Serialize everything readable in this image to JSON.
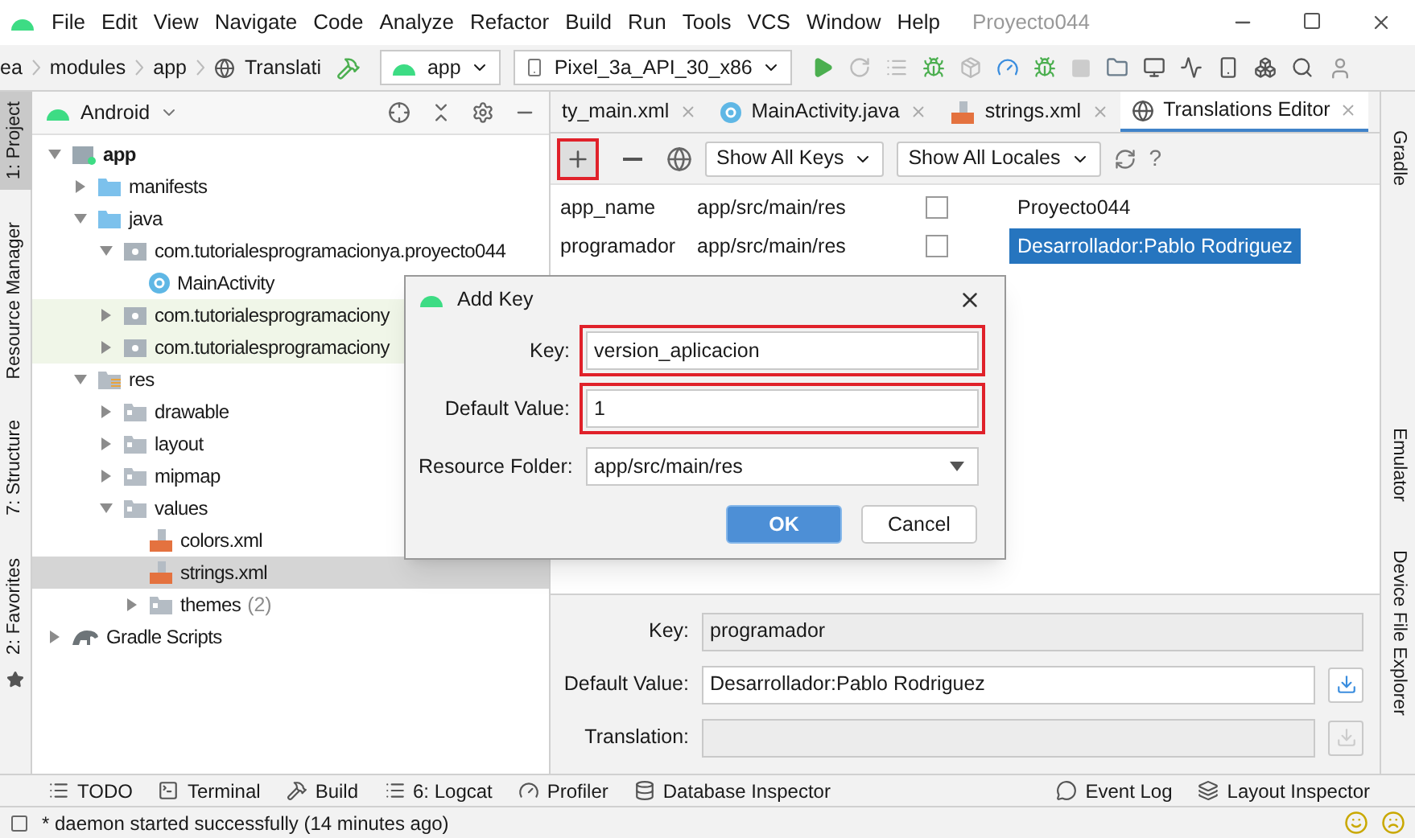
{
  "window": {
    "title": "Proyecto044",
    "menu": [
      "File",
      "Edit",
      "View",
      "Navigate",
      "Code",
      "Analyze",
      "Refactor",
      "Build",
      "Run",
      "Tools",
      "VCS",
      "Window",
      "Help"
    ]
  },
  "toolbar": {
    "breadcrumbs": [
      "ea",
      "modules",
      "app",
      "Translati"
    ],
    "run_config": "app",
    "device": "Pixel_3a_API_30_x86"
  },
  "left_strip": [
    {
      "label": "1: Project",
      "selected": true
    },
    {
      "label": "Resource Manager",
      "selected": false
    },
    {
      "label": "7: Structure",
      "selected": false
    },
    {
      "label": "2: Favorites",
      "selected": false
    }
  ],
  "right_strip": [
    {
      "label": "Gradle"
    },
    {
      "label": "Emulator"
    },
    {
      "label": "Device File Explorer"
    }
  ],
  "project": {
    "view": "Android",
    "tree": [
      {
        "label": "app",
        "kind": "module",
        "bold": true,
        "expanded": true,
        "selected": false,
        "tinted": false,
        "children": [
          {
            "label": "manifests",
            "kind": "folder-blue",
            "bold": false,
            "expanded": false,
            "selected": false,
            "tinted": false
          },
          {
            "label": "java",
            "kind": "folder-blue",
            "bold": false,
            "expanded": true,
            "selected": false,
            "tinted": false,
            "children": [
              {
                "label": "com.tutorialesprogramacionya.proyecto044",
                "kind": "package",
                "bold": false,
                "expanded": true,
                "selected": false,
                "tinted": false,
                "children": [
                  {
                    "label": "MainActivity",
                    "kind": "class",
                    "bold": false,
                    "selected": false,
                    "tinted": false
                  }
                ]
              },
              {
                "label": "com.tutorialesprogramaciony",
                "kind": "package",
                "bold": false,
                "expanded": false,
                "selected": false,
                "tinted": true
              },
              {
                "label": "com.tutorialesprogramaciony",
                "kind": "package",
                "bold": false,
                "expanded": false,
                "selected": false,
                "tinted": true
              }
            ]
          },
          {
            "label": "res",
            "kind": "res",
            "bold": false,
            "expanded": true,
            "selected": false,
            "tinted": false,
            "children": [
              {
                "label": "drawable",
                "kind": "folder",
                "bold": false,
                "expanded": false,
                "selected": false,
                "tinted": false
              },
              {
                "label": "layout",
                "kind": "folder",
                "bold": false,
                "expanded": false,
                "selected": false,
                "tinted": false
              },
              {
                "label": "mipmap",
                "kind": "folder",
                "bold": false,
                "expanded": false,
                "selected": false,
                "tinted": false
              },
              {
                "label": "values",
                "kind": "folder",
                "bold": false,
                "expanded": true,
                "selected": false,
                "tinted": false,
                "children": [
                  {
                    "label": "colors.xml",
                    "kind": "xml",
                    "bold": false,
                    "selected": false,
                    "tinted": false
                  },
                  {
                    "label": "strings.xml",
                    "kind": "xml",
                    "bold": false,
                    "selected": true,
                    "tinted": false
                  },
                  {
                    "label": "themes",
                    "count": "(2)",
                    "kind": "folder",
                    "bold": false,
                    "expanded": false,
                    "selected": false,
                    "tinted": false
                  }
                ]
              }
            ]
          }
        ]
      },
      {
        "label": "Gradle Scripts",
        "kind": "gradle",
        "bold": false,
        "expanded": false,
        "selected": false,
        "tinted": false
      }
    ]
  },
  "editor_tabs": [
    {
      "label": "ty_main.xml",
      "kind": "layout",
      "selected": false
    },
    {
      "label": "MainActivity.java",
      "kind": "class",
      "selected": false
    },
    {
      "label": "strings.xml",
      "kind": "xml",
      "selected": false
    },
    {
      "label": "Translations Editor",
      "kind": "globe",
      "selected": true
    }
  ],
  "translations": {
    "toolbar": [
      {
        "kind": "add",
        "highlighted": true
      },
      {
        "kind": "remove",
        "highlighted": false
      }
    ],
    "filters": [
      "Show All Keys",
      "Show All Locales"
    ],
    "help": "?",
    "rows": [
      {
        "key": "app_name",
        "folder": "app/src/main/res",
        "untranslatable": false,
        "value": "Proyecto044",
        "selected": false
      },
      {
        "key": "programador",
        "folder": "app/src/main/res",
        "untranslatable": false,
        "value": "Desarrollador:Pablo Rodriguez",
        "selected": true
      }
    ],
    "details": [
      {
        "label": "Key:",
        "value": "programador",
        "disabled": true,
        "has_button": false
      },
      {
        "label": "Default Value:",
        "value": "Desarrollador:Pablo Rodriguez",
        "disabled": false,
        "has_button": true
      },
      {
        "label": "Translation:",
        "disabled": true,
        "has_button": true
      }
    ]
  },
  "dialog": {
    "title": "Add Key",
    "fields": [
      {
        "label": "Key:",
        "value": "version_aplicacion",
        "kind": "text",
        "highlighted": true
      },
      {
        "label": "Default Value:",
        "value": "1",
        "kind": "text",
        "highlighted": true
      },
      {
        "label": "Resource Folder:",
        "value": "app/src/main/res",
        "kind": "dropdown",
        "highlighted": false
      }
    ],
    "buttons": [
      {
        "label": "OK",
        "primary": true
      },
      {
        "label": "Cancel",
        "primary": false
      }
    ]
  },
  "bottom_tools": {
    "left": [
      {
        "label": "TODO",
        "kind": "list"
      },
      {
        "label": "Terminal",
        "kind": "terminal"
      },
      {
        "label": "Build",
        "kind": "hammer"
      },
      {
        "label": "6: Logcat",
        "kind": "logcat"
      },
      {
        "label": "Profiler",
        "kind": "gauge"
      },
      {
        "label": "Database Inspector",
        "kind": "database"
      }
    ],
    "right": [
      {
        "label": "Event Log",
        "kind": "bubble"
      },
      {
        "label": "Layout Inspector",
        "kind": "inspector"
      }
    ]
  },
  "status_bar": {
    "message": "* daemon started successfully (14 minutes ago)"
  }
}
